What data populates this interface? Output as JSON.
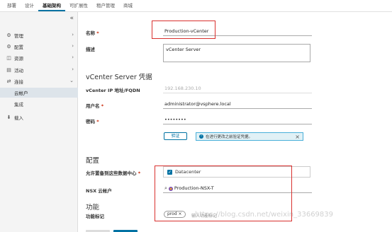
{
  "topnav": {
    "tabs": [
      {
        "label": "部署",
        "active": false
      },
      {
        "label": "设计",
        "active": false
      },
      {
        "label": "基础架构",
        "active": true
      },
      {
        "label": "可扩展性",
        "active": false
      },
      {
        "label": "租户管理",
        "active": false
      },
      {
        "label": "商城",
        "active": false
      }
    ]
  },
  "sidebar": {
    "collapse_icon": "«",
    "items": [
      {
        "label": "管理",
        "icon": "gear-icon",
        "expanded": false
      },
      {
        "label": "配置",
        "icon": "settings-icon",
        "expanded": false
      },
      {
        "label": "资源",
        "icon": "resources-icon",
        "expanded": false
      },
      {
        "label": "活动",
        "icon": "activity-icon",
        "expanded": false
      },
      {
        "label": "连接",
        "icon": "connection-icon",
        "expanded": true
      }
    ],
    "sub_items": [
      {
        "label": "云帐户",
        "selected": true
      },
      {
        "label": "集成",
        "selected": false
      }
    ],
    "import_item": {
      "label": "载入",
      "icon": "import-icon"
    }
  },
  "form": {
    "name_label": "名称",
    "name_value": "Production-vCenter",
    "desc_label": "描述",
    "desc_value": "vCenter Server",
    "vcenter_section": "vCenter Server 凭据",
    "ip_label": "vCenter IP 地址/FQDN",
    "ip_value": "192.168.230.10",
    "user_label": "用户名",
    "user_value": "administrator@vsphere.local",
    "password_label": "密码",
    "password_value": "••••••••",
    "validate_button": "验证",
    "alert_text": "在进行更改之前验证凭据。",
    "config_section": "配置",
    "datacenter_label": "允许置备到这些数据中心",
    "datacenter_value": "Datacenter",
    "nsx_label": "NSX 云帐户",
    "nsx_value": "Production-NSX-T",
    "capability_section": "功能",
    "tags_label": "功能标记",
    "tag_chip": "prod",
    "tag_placeholder": "输入功能标记",
    "required_mark": "*"
  },
  "watermark": "https://blog.csdn.net/weixin_33669839",
  "colors": {
    "accent": "#0072a3",
    "highlight": "#d9302e"
  }
}
